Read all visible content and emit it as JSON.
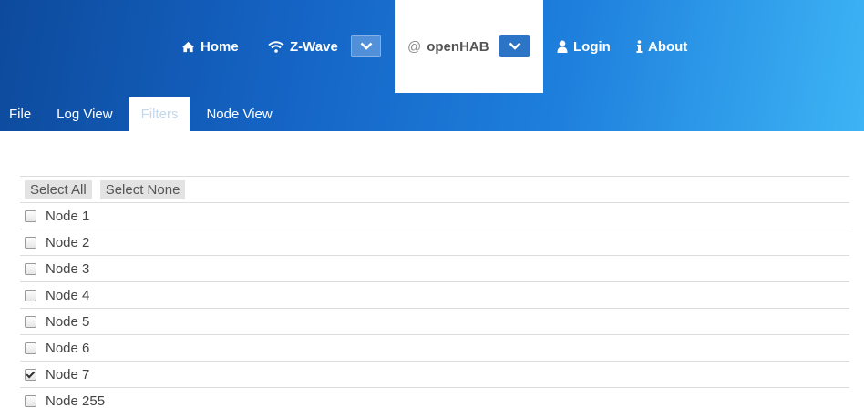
{
  "nav": {
    "home": "Home",
    "zwave": "Z-Wave",
    "openhab_prefix": "@",
    "openhab": "openHAB",
    "login": "Login",
    "about": "About"
  },
  "tabs": [
    "File",
    "Log View",
    "Filters",
    "Node View"
  ],
  "active_tab": "Filters",
  "filters": {
    "select_all": "Select All",
    "select_none": "Select None",
    "nodes": [
      {
        "label": "Node 1",
        "checked": false
      },
      {
        "label": "Node 2",
        "checked": false
      },
      {
        "label": "Node 3",
        "checked": false
      },
      {
        "label": "Node 4",
        "checked": false
      },
      {
        "label": "Node 5",
        "checked": false
      },
      {
        "label": "Node 6",
        "checked": false
      },
      {
        "label": "Node 7",
        "checked": true
      },
      {
        "label": "Node 255",
        "checked": false
      }
    ]
  },
  "colors": {
    "header_start": "#0d4a9c",
    "header_end": "#3db4f5",
    "dropdown_accent": "#2b74c6"
  }
}
